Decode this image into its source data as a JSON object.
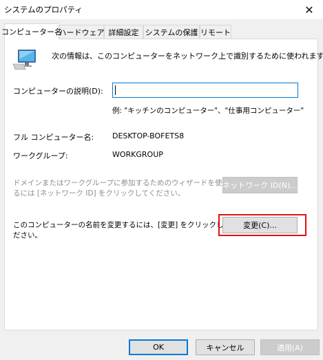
{
  "window": {
    "title": "システムのプロパティ",
    "close_glyph": "✕"
  },
  "tabs": [
    {
      "label": "コンピューター名",
      "active": true
    },
    {
      "label": "ハードウェア",
      "active": false
    },
    {
      "label": "詳細設定",
      "active": false
    },
    {
      "label": "システムの保護",
      "active": false
    },
    {
      "label": "リモート",
      "active": false
    }
  ],
  "panel": {
    "icon": "computer-icon",
    "intro_text": "次の情報は、このコンピューターをネットワーク上で識別するために使われます。",
    "description_label": "コンピューターの説明(D):",
    "description_value": "",
    "description_example": "例: \"キッチンのコンピューター\"、\"仕事用コンピューター\"",
    "full_name_label": "フル コンピューター名:",
    "full_name_value": "DESKTOP-BOFETS8",
    "workgroup_label": "ワークグループ:",
    "workgroup_value": "WORKGROUP",
    "domain_wizard_text_line1": "ドメインまたはワークグループに参加するためのウィザードを使用す",
    "domain_wizard_text_line2": "るには [ネットワーク ID] をクリックしてください。",
    "network_id_button": "ネットワーク ID(N)...",
    "rename_text_line1": "このコンピューターの名前を変更するには、[変更] をクリックしてく",
    "rename_text_line2": "ださい。",
    "change_button": "変更(C)..."
  },
  "footer": {
    "ok_button": "OK",
    "cancel_button": "キャンセル",
    "apply_button": "適用(A)"
  },
  "colors": {
    "highlight": "#e01010",
    "focus_border": "#0078d7"
  }
}
